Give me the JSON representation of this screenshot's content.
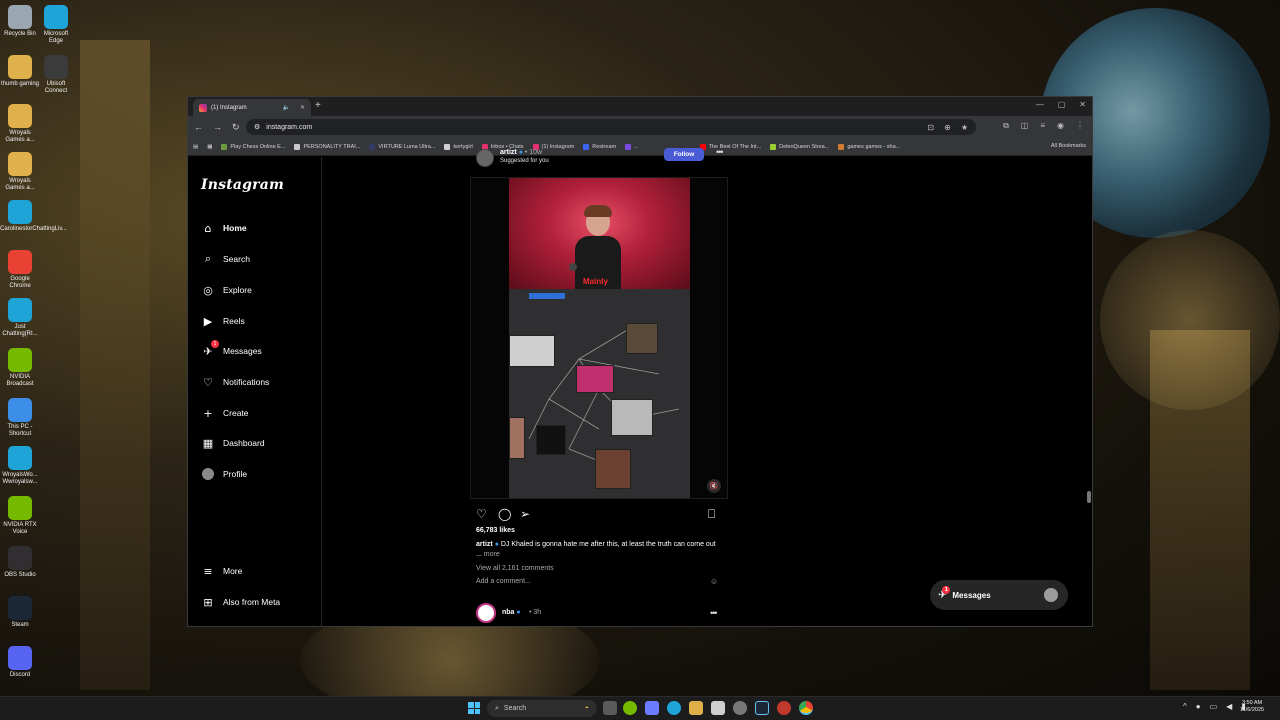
{
  "desktop": {
    "icons": [
      {
        "label": "Recycle Bin",
        "icon": "recycle-bin-icon",
        "color": "#9aa7b0"
      },
      {
        "label": "Microsoft Edge",
        "icon": "edge-icon",
        "color": "#1fa4d8"
      },
      {
        "label": "thumb gaming",
        "icon": "folder-icon",
        "color": "#e0b14a"
      },
      {
        "label": "Ubisoft Connect",
        "icon": "ubisoft-icon",
        "color": "#3b3b3b"
      },
      {
        "label": "Wroyals Games a...",
        "icon": "folder-icon",
        "color": "#e0b14a"
      },
      {
        "label": "Wroyals Games a...",
        "icon": "folder-icon",
        "color": "#e0b14a"
      },
      {
        "label": "CarolinestorChattingLiv...",
        "icon": "edge-icon",
        "color": "#1fa4d8"
      },
      {
        "label": "Google Chrome",
        "icon": "chrome-icon",
        "color": "#e94235"
      },
      {
        "label": "Just Chatting(RI...",
        "icon": "edge-icon",
        "color": "#1fa4d8"
      },
      {
        "label": "NVIDIA Broadcast",
        "icon": "nvidia-icon",
        "color": "#76b900"
      },
      {
        "label": "This PC - Shortcut",
        "icon": "pc-icon",
        "color": "#3d8ee8"
      },
      {
        "label": "WroyalsWo... Wwroyalsw...",
        "icon": "edge-icon",
        "color": "#1fa4d8"
      },
      {
        "label": "NVIDIA RTX Voice",
        "icon": "nvidia-icon",
        "color": "#76b900"
      },
      {
        "label": "OBS Studio",
        "icon": "obs-icon",
        "color": "#302e31"
      },
      {
        "label": "Steam",
        "icon": "steam-icon",
        "color": "#1b2838"
      },
      {
        "label": "Discord",
        "icon": "discord-icon",
        "color": "#5865f2"
      }
    ]
  },
  "browser": {
    "tab_title": "(1) Instagram",
    "new_tab": "+",
    "url": "instagram.com",
    "bookmarks": [
      {
        "label": "Play Chess Online E...",
        "color": "#6c9a3c"
      },
      {
        "label": "PERSONALITY TRAI...",
        "color": "#c9c9c9"
      },
      {
        "label": "VIRTURE Luma Ultra...",
        "color": "#333a66"
      },
      {
        "label": "kertygirl",
        "color": "#d0d0d0"
      },
      {
        "label": "Inbox • Chats",
        "color": "#e1306c"
      },
      {
        "label": "(1) Instagram",
        "color": "#e1306c"
      },
      {
        "label": "Restream",
        "color": "#3b63f5"
      },
      {
        "label": "...",
        "color": "#7a49e0"
      },
      {
        "label": "The Best Of The Int...",
        "color": "#ff0000"
      },
      {
        "label": "DelenQueen Strea...",
        "color": "#9acd32"
      },
      {
        "label": "games games - sha...",
        "color": "#d27a2c"
      }
    ],
    "all_bookmarks": "All Bookmarks"
  },
  "instagram": {
    "logo": "Instagram",
    "nav": [
      {
        "label": "Home",
        "icon": "home-icon",
        "glyph": "⌂",
        "active": true
      },
      {
        "label": "Search",
        "icon": "search-icon",
        "glyph": "⌕"
      },
      {
        "label": "Explore",
        "icon": "compass-icon",
        "glyph": "◎"
      },
      {
        "label": "Reels",
        "icon": "reels-icon",
        "glyph": "▶"
      },
      {
        "label": "Messages",
        "icon": "messenger-icon",
        "glyph": "✈",
        "badge": "1"
      },
      {
        "label": "Notifications",
        "icon": "heart-icon",
        "glyph": "♡"
      },
      {
        "label": "Create",
        "icon": "plus-icon",
        "glyph": "+"
      },
      {
        "label": "Dashboard",
        "icon": "dashboard-icon",
        "glyph": "▦"
      },
      {
        "label": "Profile",
        "icon": "avatar-icon",
        "glyph": ""
      }
    ],
    "nav_bottom": [
      {
        "label": "More",
        "icon": "menu-icon",
        "glyph": "≡"
      },
      {
        "label": "Also from Meta",
        "icon": "meta-icon",
        "glyph": "⊞"
      }
    ],
    "post": {
      "username": "artizt",
      "time": "• 10w",
      "suggested": "Suggested for you",
      "follow": "Follow",
      "caption_overlay": "Mainly",
      "likes": "66,783 likes",
      "caption_user": "artizt",
      "caption_text": "DJ Khaled is gonna hate me after this, at least the truth can come out ...",
      "caption_more": "more",
      "view_comments": "View all 2,161 comments",
      "add_comment": "Add a comment..."
    },
    "next_post": {
      "username": "nba",
      "time": "• 3h"
    },
    "messages_pill": {
      "label": "Messages",
      "badge": "1"
    }
  },
  "taskbar": {
    "search": "Search",
    "time": "3:50 AM",
    "date": "11/6/2025"
  }
}
